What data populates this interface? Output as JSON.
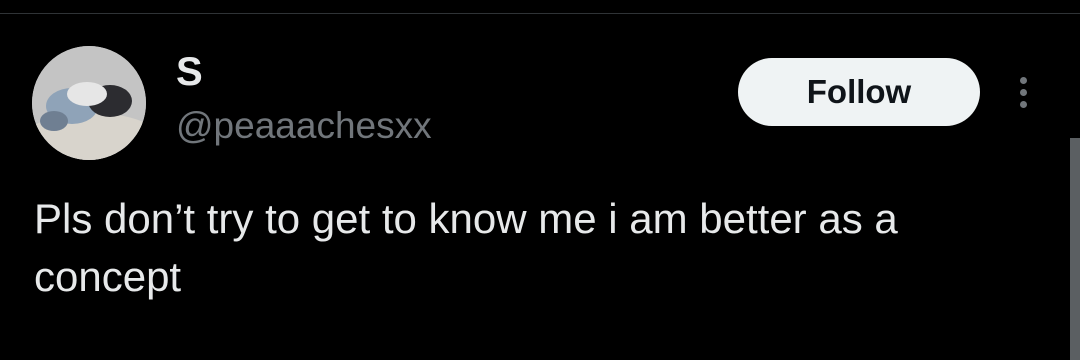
{
  "tweet": {
    "author": {
      "display_name": "S",
      "handle": "@peaaachesxx",
      "avatar_icon": "profile-photo"
    },
    "follow_label": "Follow",
    "more_icon": "more-options-icon",
    "text": "Pls don’t try to get to know me i am better as a concept"
  },
  "colors": {
    "background": "#000000",
    "primary_text": "#e7e9ea",
    "secondary_text": "#71767b",
    "follow_button_bg": "#eff3f4",
    "follow_button_text": "#0f1419"
  }
}
